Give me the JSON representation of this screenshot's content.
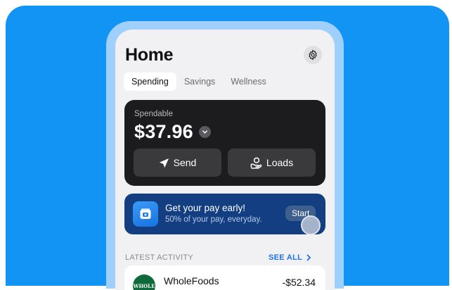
{
  "header": {
    "title": "Home",
    "settings_icon": "gear-icon"
  },
  "tabs": [
    {
      "label": "Spending",
      "active": true
    },
    {
      "label": "Savings",
      "active": false
    },
    {
      "label": "Wellness",
      "active": false
    }
  ],
  "spendable": {
    "label": "Spendable",
    "amount": "$37.96",
    "actions": [
      {
        "label": "Send",
        "icon": "send-arrow-icon"
      },
      {
        "label": "Loads",
        "icon": "hand-coin-icon"
      }
    ]
  },
  "promo": {
    "title": "Get your pay early!",
    "subtitle": "50% of your pay, everyday.",
    "button_label": "Start",
    "icon": "pay-card-icon"
  },
  "activity": {
    "header": "LATEST ACTIVITY",
    "see_all": "SEE ALL",
    "items": [
      {
        "logo_text": "WHOLE",
        "name": "WholeFoods",
        "amount": "-$52.34"
      }
    ]
  },
  "colors": {
    "background": "#1294f5",
    "frame": "#9fd0fb",
    "card_dark": "#1c1c1e",
    "promo_blue": "#133f82",
    "link_blue": "#1a73e8"
  }
}
